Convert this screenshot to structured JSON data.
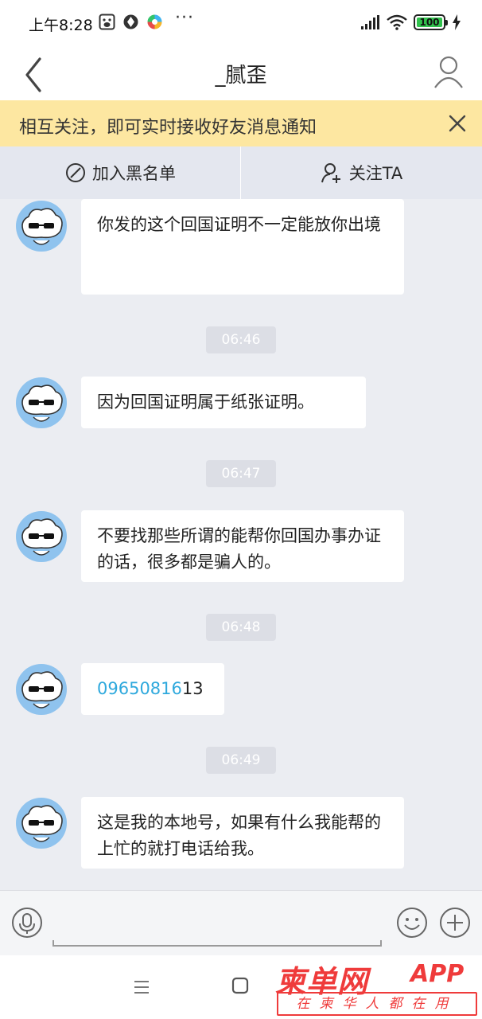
{
  "status_bar": {
    "time": "上午8:28",
    "dots": "···",
    "battery": "100",
    "icons": [
      "baidu-icon",
      "app-icon",
      "app-color-icon",
      "signal-icon",
      "wifi-icon",
      "battery-icon",
      "charging-icon"
    ]
  },
  "header": {
    "title": "_腻歪",
    "back_icon": "chevron-left-icon",
    "profile_icon": "user-icon"
  },
  "notice": {
    "text": "相互关注，即可实时接收好友消息通知",
    "close_icon": "close-icon"
  },
  "actions": {
    "blacklist_label": "加入黑名单",
    "follow_label": "关注TA"
  },
  "messages": [
    {
      "text": "你发的这个回国证明不一定能放你出境"
    },
    {
      "timestamp": "06:46"
    },
    {
      "text": "因为回国证明属于纸张证明。"
    },
    {
      "timestamp": "06:47"
    },
    {
      "text": "不要找那些所谓的能帮你回国办事办证的话，很多都是骗人的。"
    },
    {
      "timestamp": "06:48"
    },
    {
      "link_text": "09650816",
      "rest_text": "13"
    },
    {
      "timestamp": "06:49"
    },
    {
      "text": "这是我的本地号，如果有什么我能帮的上忙的就打电话给我。"
    }
  ],
  "input_bar": {
    "voice_icon": "microphone-icon",
    "emoji_icon": "smiley-icon",
    "plus_icon": "plus-circle-icon"
  },
  "nav": {
    "menu_icon": "menu-icon",
    "home_icon": "square-icon"
  },
  "watermark": {
    "brand": "柬单网",
    "app": "APP",
    "slogan": "在柬华人都在用"
  },
  "colors": {
    "notice_bg": "#fde7a1",
    "link": "#2fa9dd",
    "chat_bg": "#ebedf2",
    "watermark": "#ef3b3b"
  }
}
